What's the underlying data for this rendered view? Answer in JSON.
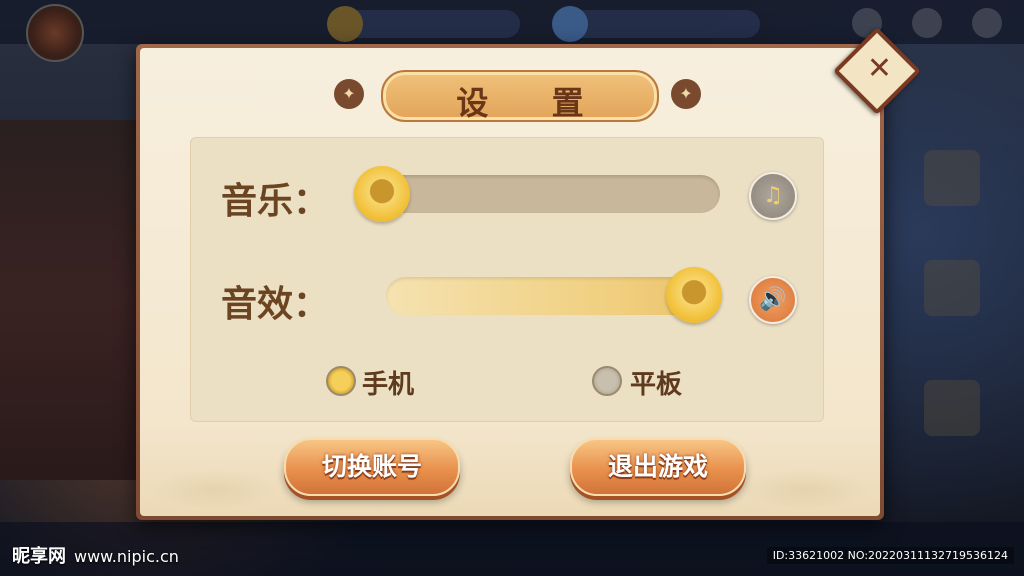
{
  "dialog": {
    "title": "设 置",
    "close_glyph": "✕"
  },
  "settings": {
    "music_label": "音乐：",
    "music_level": 0.0,
    "sfx_label": "音效：",
    "sfx_level": 1.0,
    "music_icon": "music-note-icon",
    "sfx_icon": "speaker-icon"
  },
  "device": {
    "options": [
      {
        "label": "手机",
        "selected": true
      },
      {
        "label": "平板",
        "selected": false
      }
    ]
  },
  "actions": {
    "switch_account": "切换账号",
    "exit_game": "退出游戏"
  },
  "watermark": {
    "brand": "昵享网",
    "url": "www.nipic.cn",
    "id_text": "ID:33621002 NO:20220311132719536124"
  },
  "colors": {
    "accent_gold": "#f2c23c",
    "button_orange": "#e9914c",
    "text_brown": "#6b4522"
  }
}
